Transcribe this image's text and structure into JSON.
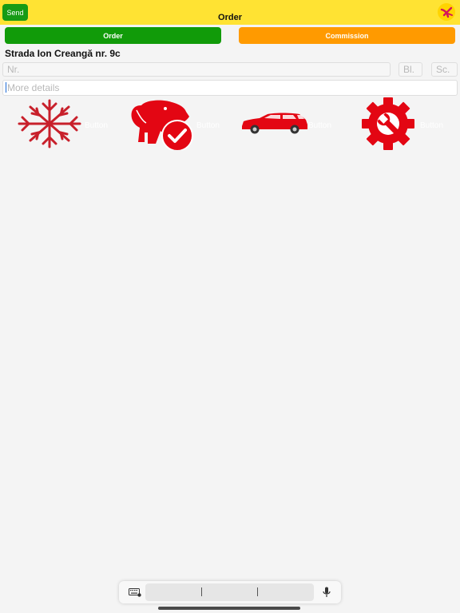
{
  "header": {
    "send_label": "Send",
    "title": "Order",
    "bg_color": "#ffe333"
  },
  "tabs": {
    "order_label": "Order",
    "commission_label": "Commission",
    "order_color": "#119b09",
    "commission_color": "#ff9a00"
  },
  "address": {
    "text": "Strada Ion Creangă nr. 9c"
  },
  "fields": {
    "nr_placeholder": "Nr.",
    "bl_placeholder": "Bl.",
    "sc_placeholder": "Sc.",
    "details_placeholder": "More details"
  },
  "options": [
    {
      "icon": "snowflake-icon",
      "label": "Button"
    },
    {
      "icon": "pet-check-icon",
      "label": "Button"
    },
    {
      "icon": "car-icon",
      "label": "Button"
    },
    {
      "icon": "gear-wrench-icon",
      "label": "Button"
    }
  ],
  "accent_red": "#e30613"
}
